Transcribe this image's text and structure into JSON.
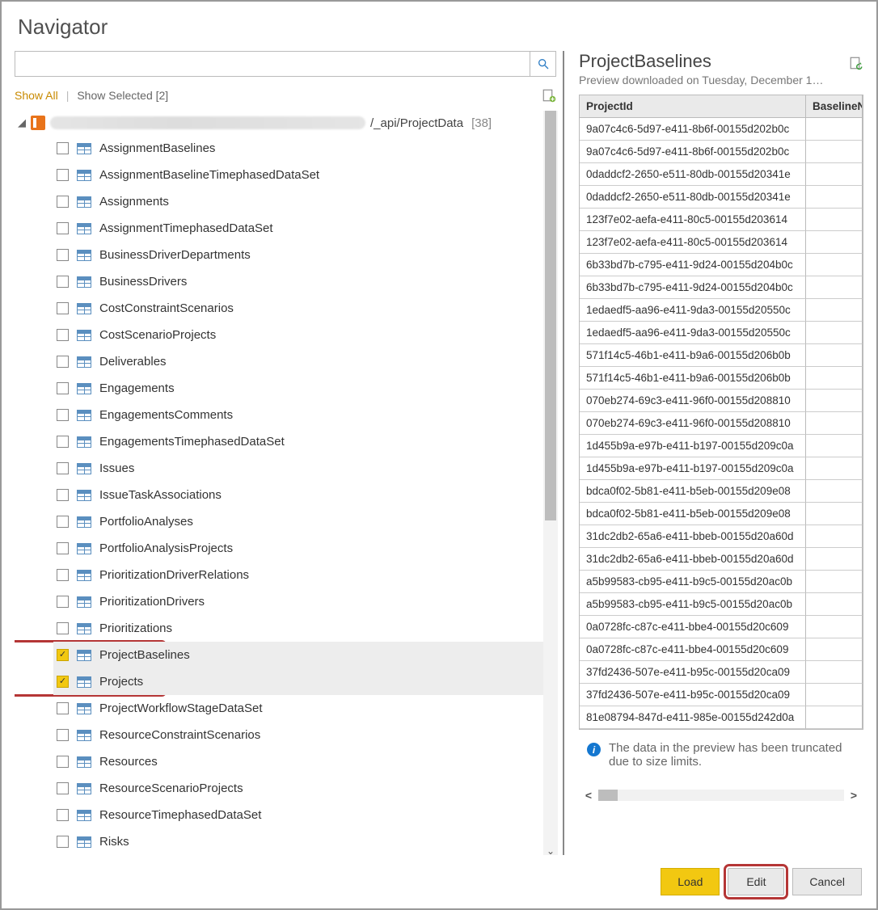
{
  "title": "Navigator",
  "search": {
    "placeholder": ""
  },
  "filters": {
    "show_all": "Show All",
    "show_selected": "Show Selected [2]"
  },
  "root": {
    "suffix": "/_api/ProjectData",
    "count": "[38]"
  },
  "tables": [
    {
      "name": "AssignmentBaselines",
      "checked": false
    },
    {
      "name": "AssignmentBaselineTimephasedDataSet",
      "checked": false
    },
    {
      "name": "Assignments",
      "checked": false
    },
    {
      "name": "AssignmentTimephasedDataSet",
      "checked": false
    },
    {
      "name": "BusinessDriverDepartments",
      "checked": false
    },
    {
      "name": "BusinessDrivers",
      "checked": false
    },
    {
      "name": "CostConstraintScenarios",
      "checked": false
    },
    {
      "name": "CostScenarioProjects",
      "checked": false
    },
    {
      "name": "Deliverables",
      "checked": false
    },
    {
      "name": "Engagements",
      "checked": false
    },
    {
      "name": "EngagementsComments",
      "checked": false
    },
    {
      "name": "EngagementsTimephasedDataSet",
      "checked": false
    },
    {
      "name": "Issues",
      "checked": false
    },
    {
      "name": "IssueTaskAssociations",
      "checked": false
    },
    {
      "name": "PortfolioAnalyses",
      "checked": false
    },
    {
      "name": "PortfolioAnalysisProjects",
      "checked": false
    },
    {
      "name": "PrioritizationDriverRelations",
      "checked": false
    },
    {
      "name": "PrioritizationDrivers",
      "checked": false
    },
    {
      "name": "Prioritizations",
      "checked": false
    },
    {
      "name": "ProjectBaselines",
      "checked": true
    },
    {
      "name": "Projects",
      "checked": true
    },
    {
      "name": "ProjectWorkflowStageDataSet",
      "checked": false
    },
    {
      "name": "ResourceConstraintScenarios",
      "checked": false
    },
    {
      "name": "Resources",
      "checked": false
    },
    {
      "name": "ResourceScenarioProjects",
      "checked": false
    },
    {
      "name": "ResourceTimephasedDataSet",
      "checked": false
    },
    {
      "name": "Risks",
      "checked": false
    }
  ],
  "preview": {
    "title": "ProjectBaselines",
    "subtitle": "Preview downloaded on Tuesday, December 1…",
    "columns": [
      "ProjectId",
      "BaselineN"
    ],
    "rows": [
      "9a07c4c6-5d97-e411-8b6f-00155d202b0c",
      "9a07c4c6-5d97-e411-8b6f-00155d202b0c",
      "0daddcf2-2650-e511-80db-00155d20341e",
      "0daddcf2-2650-e511-80db-00155d20341e",
      "123f7e02-aefa-e411-80c5-00155d203614",
      "123f7e02-aefa-e411-80c5-00155d203614",
      "6b33bd7b-c795-e411-9d24-00155d204b0c",
      "6b33bd7b-c795-e411-9d24-00155d204b0c",
      "1edaedf5-aa96-e411-9da3-00155d20550c",
      "1edaedf5-aa96-e411-9da3-00155d20550c",
      "571f14c5-46b1-e411-b9a6-00155d206b0b",
      "571f14c5-46b1-e411-b9a6-00155d206b0b",
      "070eb274-69c3-e411-96f0-00155d208810",
      "070eb274-69c3-e411-96f0-00155d208810",
      "1d455b9a-e97b-e411-b197-00155d209c0a",
      "1d455b9a-e97b-e411-b197-00155d209c0a",
      "bdca0f02-5b81-e411-b5eb-00155d209e08",
      "bdca0f02-5b81-e411-b5eb-00155d209e08",
      "31dc2db2-65a6-e411-bbeb-00155d20a60d",
      "31dc2db2-65a6-e411-bbeb-00155d20a60d",
      "a5b99583-cb95-e411-b9c5-00155d20ac0b",
      "a5b99583-cb95-e411-b9c5-00155d20ac0b",
      "0a0728fc-c87c-e411-bbe4-00155d20c609",
      "0a0728fc-c87c-e411-bbe4-00155d20c609",
      "37fd2436-507e-e411-b95c-00155d20ca09",
      "37fd2436-507e-e411-b95c-00155d20ca09",
      "81e08794-847d-e411-985e-00155d242d0a"
    ],
    "truncated_msg": "The data in the preview has been truncated due to size limits."
  },
  "buttons": {
    "load": "Load",
    "edit": "Edit",
    "cancel": "Cancel"
  }
}
